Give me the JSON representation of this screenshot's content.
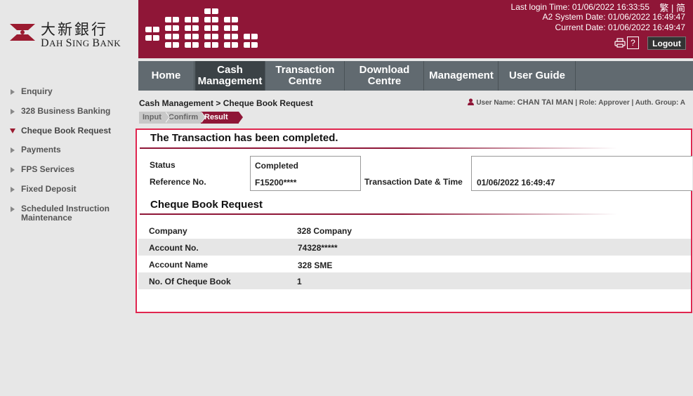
{
  "brand": {
    "name_cn": "大新銀行",
    "name_en_1": "D",
    "name_en_2": "AH ",
    "name_en_3": "S",
    "name_en_4": "ING ",
    "name_en_5": "B",
    "name_en_6": "ANK"
  },
  "header": {
    "lang": "繁 | 简",
    "last_login": "Last login Time: 01/06/2022 16:33:55",
    "system_date": "A2 System Date: 01/06/2022 16:49:47",
    "current_date": "Current Date: 01/06/2022 16:49:47",
    "help_label": "?",
    "logout_label": "Logout"
  },
  "sidebar": {
    "items": [
      {
        "label": "Enquiry"
      },
      {
        "label": "328 Business Banking"
      },
      {
        "label": "Cheque Book Request"
      },
      {
        "label": "Payments"
      },
      {
        "label": "FPS Services"
      },
      {
        "label": "Fixed Deposit"
      },
      {
        "label": "Scheduled Instruction",
        "label2": "Maintenance"
      }
    ]
  },
  "menu": {
    "tabs": [
      {
        "line1": "Home",
        "line2": ""
      },
      {
        "line1": "Cash",
        "line2": "Management"
      },
      {
        "line1": "Transaction",
        "line2": "Centre"
      },
      {
        "line1": "Download",
        "line2": "Centre"
      },
      {
        "line1": "Management",
        "line2": ""
      },
      {
        "line1": "User Guide",
        "line2": ""
      }
    ]
  },
  "breadcrumb": "Cash Management > Cheque Book Request",
  "user": {
    "label": "User Name: ",
    "name": "CHAN TAI MAN",
    "role": " | Role: Approver | Auth. Group: A"
  },
  "steps": [
    "Input",
    "Confirm",
    "Result"
  ],
  "result": {
    "title": "The Transaction has been completed.",
    "status_label": "Status",
    "status_value": "Completed",
    "ref_label": "Reference No.",
    "ref_value": "F15200****",
    "datetime_label": "Transaction Date & Time",
    "datetime_value": "01/06/2022 16:49:47"
  },
  "request": {
    "title": "Cheque Book Request",
    "rows": [
      {
        "label": "Company",
        "value": "328 Company"
      },
      {
        "label": "Account No.",
        "value": "74328*****"
      },
      {
        "label": "Account Name",
        "value": "328 SME"
      },
      {
        "label": "No. Of Cheque Book",
        "value": "1"
      }
    ]
  },
  "colors": {
    "brand": "#8f1637",
    "highlight_border": "#e0264f",
    "menu": "#616a70"
  }
}
